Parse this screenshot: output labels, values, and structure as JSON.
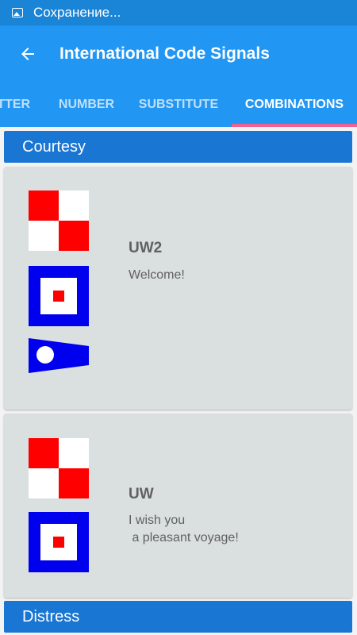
{
  "status_bar": {
    "icon": "image-icon",
    "text": "Сохранение..."
  },
  "app_bar": {
    "back_icon": "arrow-back-icon",
    "title": "International Code Signals"
  },
  "tabs": [
    {
      "label": "LETTER",
      "active": false
    },
    {
      "label": "NUMBER",
      "active": false
    },
    {
      "label": "SUBSTITUTE",
      "active": false
    },
    {
      "label": "COMBINATIONS",
      "active": true
    }
  ],
  "colors": {
    "status_bar": "#1a84d6",
    "app_bar": "#2196f3",
    "tab_indicator": "#f06292",
    "section_header": "#1976d2",
    "card": "#dadfe0",
    "flag_red": "#ff0000",
    "flag_blue": "#0000ee",
    "flag_white": "#ffffff"
  },
  "sections": [
    {
      "header": "Courtesy",
      "cards": [
        {
          "code": "UW2",
          "meaning": "Welcome!",
          "flags": [
            "flag-u-icon",
            "flag-w-icon",
            "pennant-2-icon"
          ]
        },
        {
          "code": "UW",
          "meaning": "I wish you\n a pleasant voyage!",
          "flags": [
            "flag-u-icon",
            "flag-w-icon"
          ]
        }
      ]
    },
    {
      "header": "Distress",
      "cards": []
    }
  ]
}
